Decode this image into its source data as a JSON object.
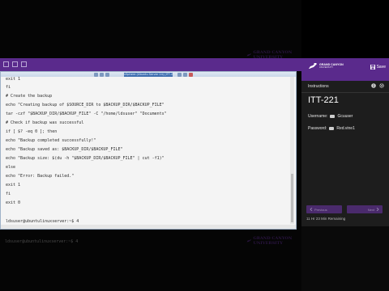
{
  "vm": {
    "title": "vSphere (Ubuntu Server 24) [ITT-221]",
    "lines": [
      "exit 1",
      "fi",
      "# Create the backup",
      "echo \"Creating backup of $SOURCE_DIR to $BACKUP_DIR/$BACKUP_FILE\"",
      "tar -czf \"$BACKUP_DIR/$BACKUP_FILE\" -C \"/home/ldsuser\" \"Documents\"",
      "# Check if backup was successful",
      "if [ $? -eq 0 ]; then",
      "echo \"Backup completed successfully!\"",
      "echo \"Backup saved as: $BACKUP_DIR/$BACKUP_FILE\"",
      "echo \"Backup size: $(du -h \"$BACKUP_DIR/$BACKUP_FILE\" | cut -f1)\"",
      "else",
      "echo \"Error: Backup failed.\"",
      "exit 1",
      "fi",
      "exit 0",
      "",
      "ldsuser@ubuntulinuxserver:~$ 4"
    ]
  },
  "background": {
    "line_a": "ldsuser@ubuntulinuxserver:~$ 4",
    "logo_text": "GRAND CANYON UNIVERSITY"
  },
  "panel": {
    "brand_name": "GRAND CANYON",
    "brand_sub": "UNIVERSITY",
    "save_label": "Save",
    "instructions_label": "Instructions",
    "lab_title": "ITT-221",
    "username_label": "Username:",
    "username_value": "Gcuuser",
    "password_label": "Password:",
    "password_value": "Red.vine1",
    "prev_label": "Previous",
    "next_label": "Next",
    "remaining": "11 Hr 23 Min Remaining"
  },
  "colors": {
    "accent": "#5a2a8c",
    "panel_bg": "#1d1d1d"
  }
}
